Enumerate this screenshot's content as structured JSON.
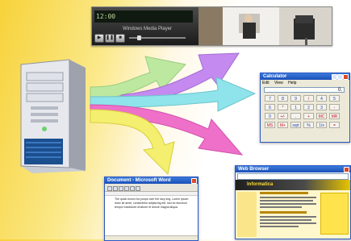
{
  "media_player": {
    "time_display": "12:00",
    "subtitle": "Windows Media Player"
  },
  "calculator": {
    "title": "Calculator",
    "menu": [
      "Edit",
      "View",
      "Help"
    ],
    "display_value": "0.",
    "keys": [
      "7",
      "8",
      "9",
      "/",
      "4",
      "5",
      "6",
      "*",
      "1",
      "2",
      "3",
      "-",
      "0",
      "+/-",
      ".",
      "+",
      "MC",
      "MR",
      "MS",
      "M+",
      "sqrt",
      "%",
      "1/x",
      "="
    ]
  },
  "word_document": {
    "title": "Document - Microsoft Word",
    "paragraph": "The quick brown fox jumps over the lazy dog. Lorem ipsum dolor sit amet, consectetur adipiscing elit, sed do eiusmod tempor incididunt ut labore et dolore magna aliqua."
  },
  "web_browser": {
    "title": "Web Browser",
    "banner": "Informatica"
  },
  "colors": {
    "arrow_green": "#bde8a0",
    "arrow_cyan": "#8fe3ea",
    "arrow_purple": "#c48aef",
    "arrow_magenta": "#ee70c9",
    "arrow_yellow": "#f4ef6f",
    "background_yellow": "#f7d23a"
  }
}
